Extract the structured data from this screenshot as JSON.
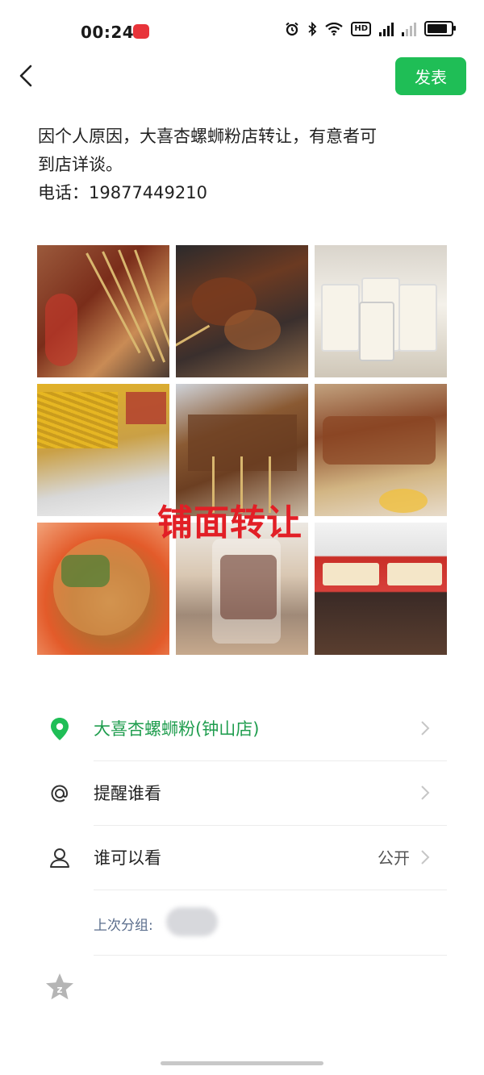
{
  "status_bar": {
    "time": "00:24"
  },
  "header": {
    "publish_label": "发表"
  },
  "post": {
    "line1": "因个人原因，大喜杏螺蛳粉店转让，有意者可",
    "line2": "到店详谈。",
    "line3": "电话：19877449210"
  },
  "images": {
    "count": 9,
    "watermark": "铺面转让"
  },
  "list": {
    "location_label": "大喜杏螺蛳粉(钟山店)",
    "remind_label": "提醒谁看",
    "visibility_label": "谁可以看",
    "visibility_value": "公开",
    "last_group_label": "上次分组:"
  },
  "colors": {
    "accent": "#1fbe56",
    "watermark": "#e21f26"
  }
}
